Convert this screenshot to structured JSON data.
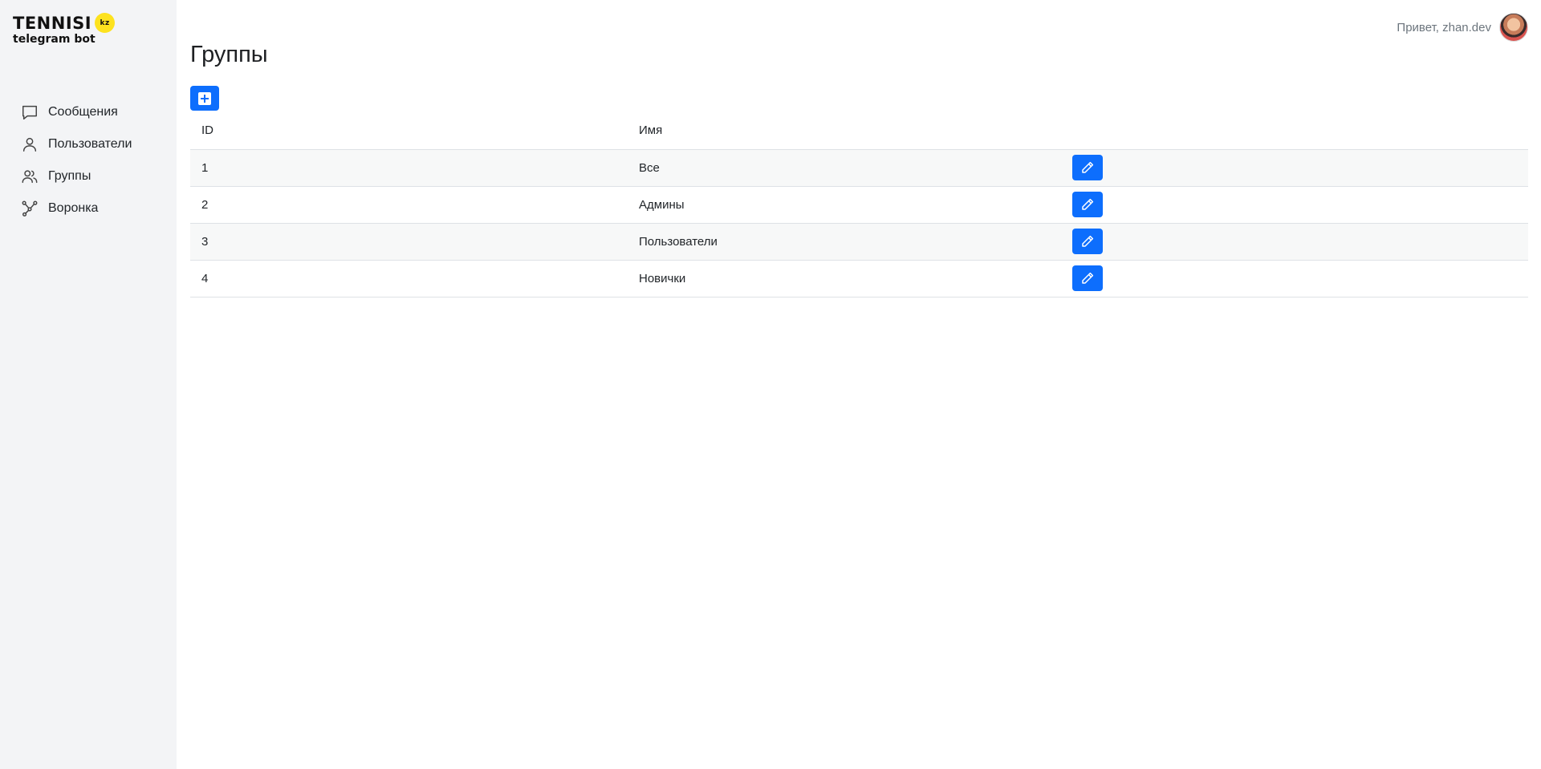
{
  "brand": {
    "title": "TENNISI",
    "badge": "kz",
    "subtitle": "telegram bot"
  },
  "sidebar": {
    "items": [
      {
        "label": "Сообщения",
        "icon": "message-icon"
      },
      {
        "label": "Пользователи",
        "icon": "user-icon"
      },
      {
        "label": "Группы",
        "icon": "users-icon"
      },
      {
        "label": "Воронка",
        "icon": "funnel-icon"
      }
    ]
  },
  "header": {
    "greeting": "Привет, zhan.dev"
  },
  "page": {
    "title": "Группы"
  },
  "table": {
    "columns": [
      "ID",
      "Имя",
      ""
    ],
    "rows": [
      {
        "id": "1",
        "name": "Все"
      },
      {
        "id": "2",
        "name": "Админы"
      },
      {
        "id": "3",
        "name": "Пользователи"
      },
      {
        "id": "4",
        "name": "Новички"
      }
    ]
  },
  "colors": {
    "primary": "#0d6efd",
    "sidebar_bg": "#f3f4f6",
    "badge": "#fde21f"
  }
}
